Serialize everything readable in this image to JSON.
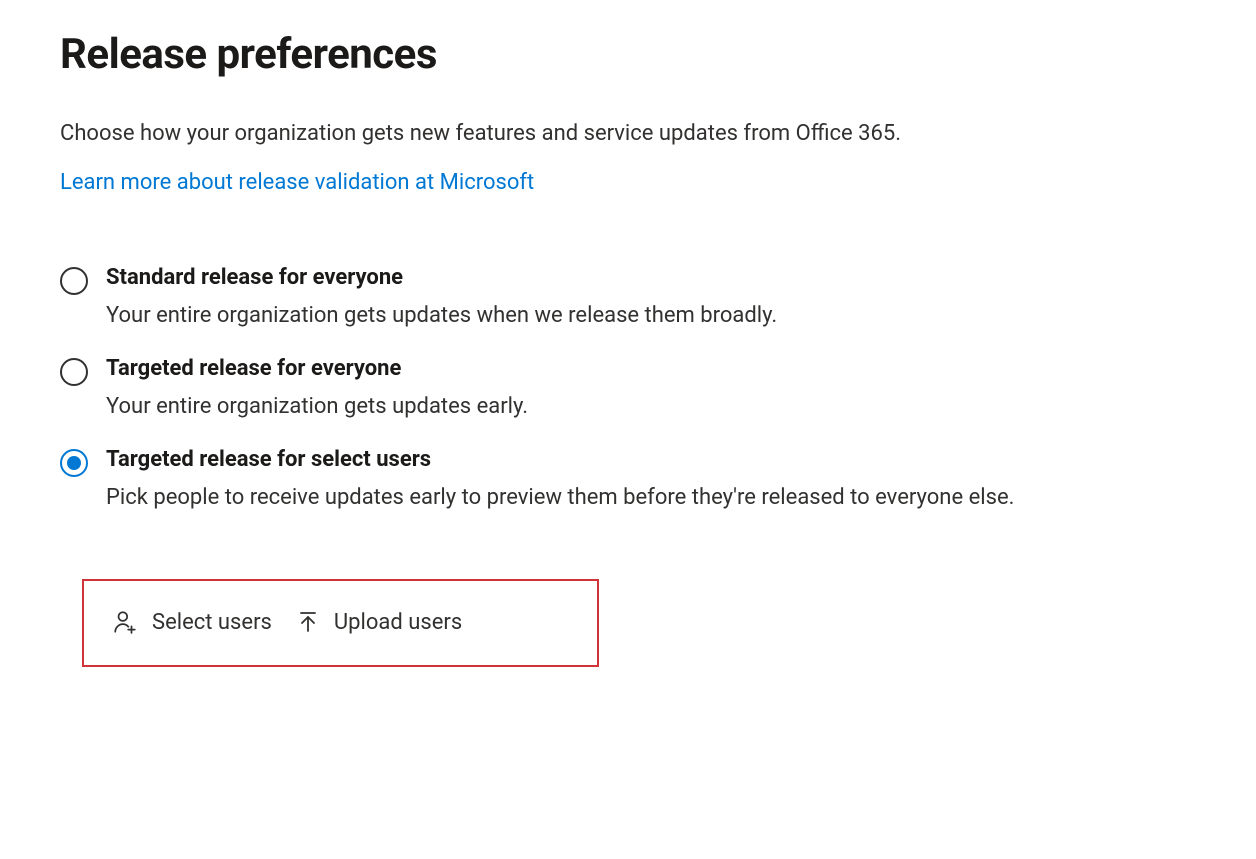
{
  "title": "Release preferences",
  "description": "Choose how your organization gets new features and service updates from Office 365.",
  "learn_link": "Learn more about release validation at Microsoft",
  "options": [
    {
      "label": "Standard release for everyone",
      "desc": "Your entire organization gets updates when we release them broadly.",
      "selected": false
    },
    {
      "label": "Targeted release for everyone",
      "desc": "Your entire organization gets updates early.",
      "selected": false
    },
    {
      "label": "Targeted release for select users",
      "desc": "Pick people to receive updates early to preview them before they're released to everyone else.",
      "selected": true
    }
  ],
  "actions": {
    "select_users": "Select users",
    "upload_users": "Upload users"
  }
}
